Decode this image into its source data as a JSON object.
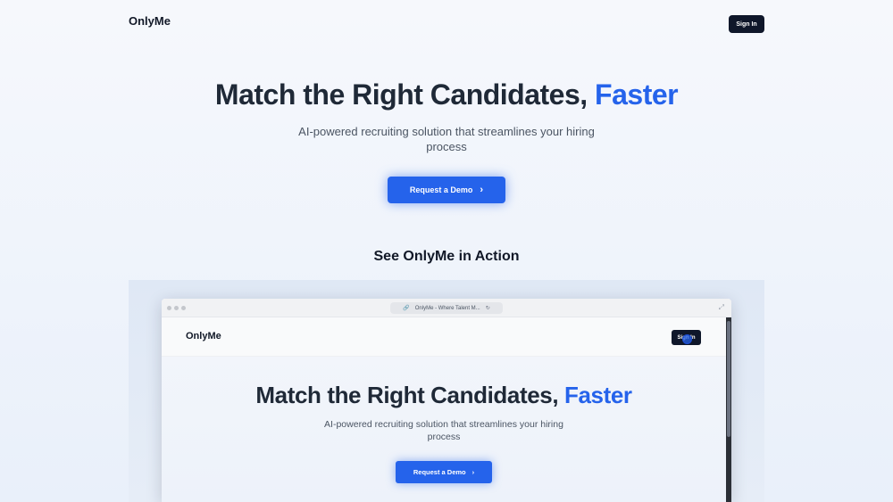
{
  "header": {
    "logo": "OnlyMe",
    "sign_in_label": "Sign In"
  },
  "hero": {
    "title_main": "Match the Right Candidates,",
    "title_accent": "Faster",
    "subtitle": "AI-powered recruiting solution that streamlines your hiring process",
    "cta_label": "Request a Demo",
    "cta_icon": "chevron-right-icon"
  },
  "demo_section": {
    "title": "See OnlyMe in Action",
    "browser": {
      "tab_title": "OnlyMe - Where Talent M...",
      "url_icon": "link-icon",
      "reload_icon": "reload-icon",
      "expand_icon": "expand-icon",
      "inner": {
        "logo": "OnlyMe",
        "sign_in_label": "Sign In",
        "title_main": "Match the Right Candidates,",
        "title_accent": "Faster",
        "subtitle": "AI-powered recruiting solution that streamlines your hiring process",
        "cta_label": "Request a Demo"
      }
    }
  },
  "colors": {
    "accent": "#2563eb",
    "dark": "#0f172a"
  }
}
